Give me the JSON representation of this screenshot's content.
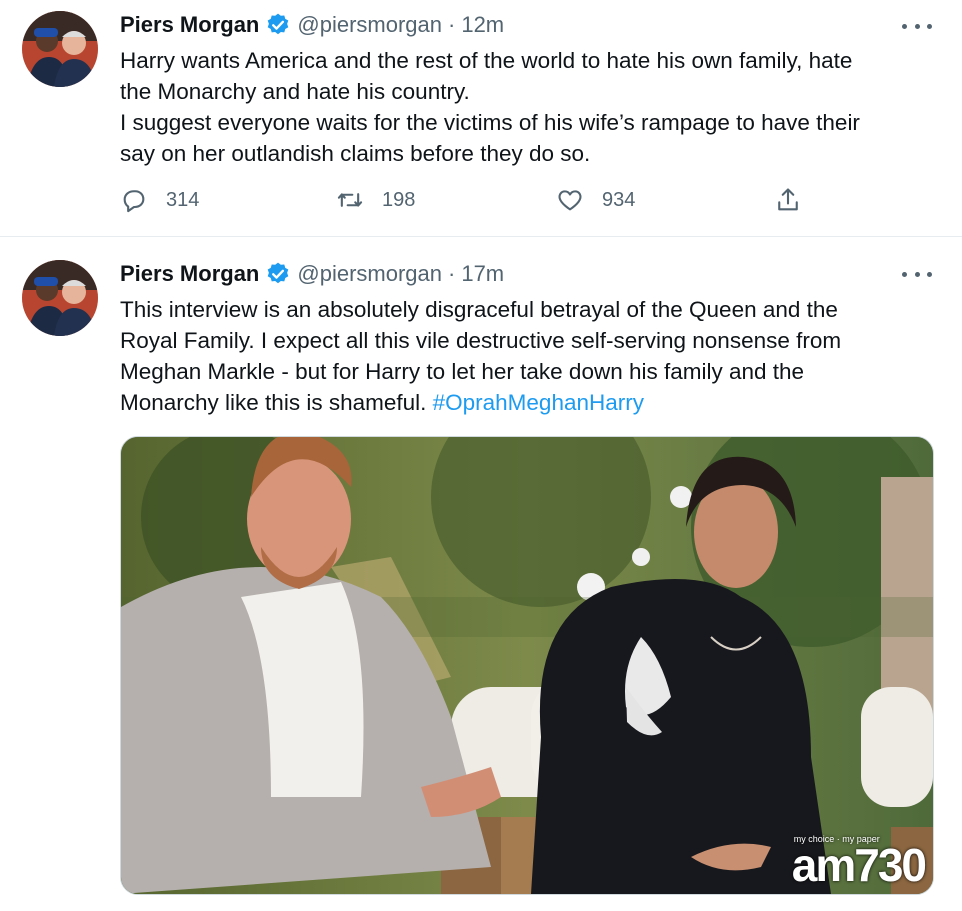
{
  "tweets": [
    {
      "display_name": "Piers Morgan",
      "handle": "@piersmorgan",
      "separator": "·",
      "time": "12m",
      "text_lines": [
        "Harry wants America and the rest of the world to hate his own family, hate",
        "the Monarchy and hate his country.",
        "I suggest everyone waits for the victims of his wife’s rampage to have their",
        "say on her outlandish claims before they do so."
      ],
      "replies": "314",
      "retweets": "198",
      "likes": "934"
    },
    {
      "display_name": "Piers Morgan",
      "handle": "@piersmorgan",
      "separator": "·",
      "time": "17m",
      "text_lines": [
        "This interview is an absolutely disgraceful betrayal of the Queen and the",
        "Royal Family. I expect all this vile destructive self-serving nonsense from",
        "Meghan Markle - but for Harry to let her take down his family and the",
        "Monarchy like this is shameful. "
      ],
      "hashtag": "#OprahMeghanHarry",
      "media_watermark": "am730",
      "media_watermark_small": "my choice · my paper"
    }
  ],
  "colors": {
    "text": "#0f1419",
    "secondary": "#536471",
    "link": "#1d9bf0",
    "verified": "#1d9bf0"
  },
  "icons": {
    "verified": "verified-badge-icon",
    "more": "more-icon",
    "reply": "reply-icon",
    "retweet": "retweet-icon",
    "like": "heart-icon",
    "share": "share-icon"
  }
}
